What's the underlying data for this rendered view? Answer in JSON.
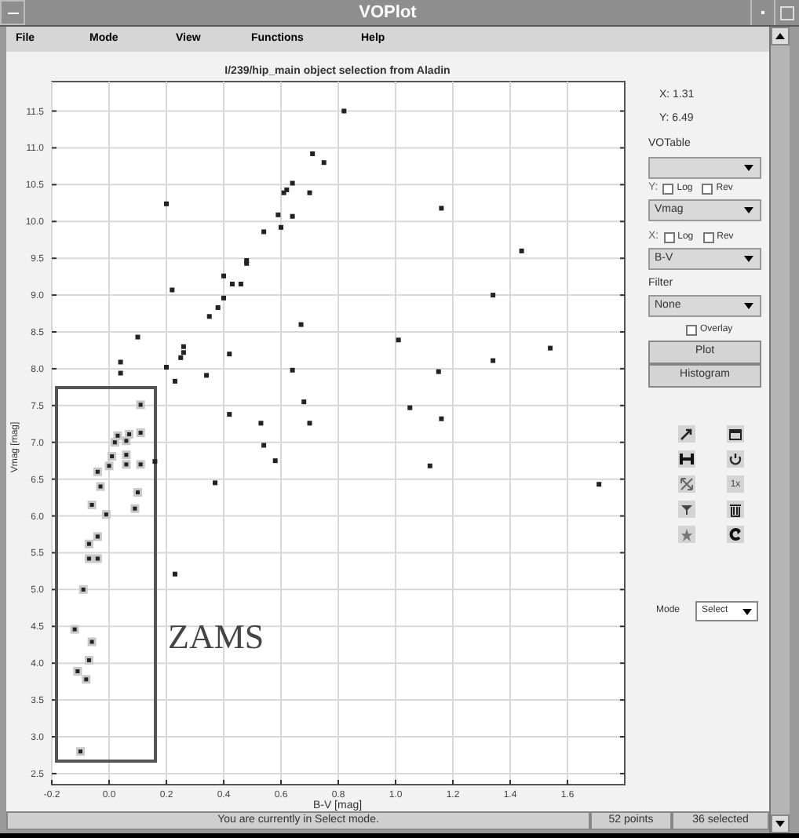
{
  "window": {
    "title": "VOPlot"
  },
  "menu": [
    "File",
    "Mode",
    "View",
    "Functions",
    "Help"
  ],
  "plot": {
    "chart_data": {
      "type": "scatter",
      "title": "I/239/hip_main object selection from Aladin",
      "xlabel": "B-V [mag]",
      "ylabel": "Vmag [mag]",
      "xlim": [
        -0.2,
        1.8
      ],
      "ylim": [
        2.35,
        11.9
      ],
      "xticks": [
        {
          "value": -0.2,
          "label": "-0.2"
        },
        {
          "value": 0,
          "label": "0.0"
        },
        {
          "value": 0.2,
          "label": "0.2"
        },
        {
          "value": 0.4,
          "label": "0.4"
        },
        {
          "value": 0.6,
          "label": "0.6"
        },
        {
          "value": 0.8,
          "label": "0.8"
        },
        {
          "value": 1,
          "label": "1.0"
        },
        {
          "value": 1.2,
          "label": "1.2"
        },
        {
          "value": 1.4,
          "label": "1.4"
        },
        {
          "value": 1.6,
          "label": "1.6"
        }
      ],
      "yticks": [
        {
          "value": 2.5,
          "label": "2.5"
        },
        {
          "value": 3,
          "label": "3.0"
        },
        {
          "value": 3.5,
          "label": "3.5"
        },
        {
          "value": 4,
          "label": "4.0"
        },
        {
          "value": 4.5,
          "label": "4.5"
        },
        {
          "value": 5,
          "label": "5.0"
        },
        {
          "value": 5.5,
          "label": "5.5"
        },
        {
          "value": 6,
          "label": "6.0"
        },
        {
          "value": 6.5,
          "label": "6.5"
        },
        {
          "value": 7,
          "label": "7.0"
        },
        {
          "value": 7.5,
          "label": "7.5"
        },
        {
          "value": 8,
          "label": "8.0"
        },
        {
          "value": 8.5,
          "label": "8.5"
        },
        {
          "value": 9,
          "label": "9.0"
        },
        {
          "value": 9.5,
          "label": "9.5"
        },
        {
          "value": 10,
          "label": "10.0"
        },
        {
          "value": 10.5,
          "label": "10.5"
        },
        {
          "value": 11,
          "label": "11.0"
        },
        {
          "value": 11.5,
          "label": "11.5"
        }
      ],
      "series": [
        {
          "color": "#222222",
          "x": [
            0.82,
            0.2,
            0.71,
            0.75,
            0.64,
            0.61,
            0.62,
            0.7,
            1.16,
            0.59,
            0.64,
            0.6,
            0.54,
            1.44,
            0.48,
            0.48,
            0.4,
            0.43,
            0.46,
            0.22,
            0.4,
            1.34,
            0.38,
            0.35,
            0.67,
            1.01,
            1.54,
            0.25,
            0.26,
            0.26,
            0.42,
            0.2,
            1.34,
            0.23,
            0.34,
            0.64,
            1.15,
            1.05,
            0.68,
            0.42,
            0.53,
            0.7,
            1.16,
            0.54,
            0.58,
            1.12,
            0.37,
            1.71,
            0.04,
            0.04,
            0.1,
            0.23,
            0.16
          ],
          "values": [
            11.5,
            10.24,
            10.92,
            10.8,
            10.52,
            10.39,
            10.43,
            10.39,
            10.18,
            10.09,
            10.07,
            9.92,
            9.86,
            9.6,
            9.43,
            9.47,
            9.26,
            9.15,
            9.15,
            9.07,
            8.96,
            9.0,
            8.83,
            8.71,
            8.6,
            8.39,
            8.28,
            8.15,
            8.3,
            8.22,
            8.2,
            8.02,
            8.11,
            7.83,
            7.91,
            7.98,
            7.96,
            7.47,
            7.55,
            7.38,
            7.26,
            7.26,
            7.32,
            6.96,
            6.75,
            6.68,
            6.45,
            6.43,
            8.09,
            7.94,
            8.43,
            5.21,
            6.74
          ]
        },
        {
          "color": "#222222",
          "x": [
            0.11,
            0.03,
            0.02,
            0.01,
            0.06,
            0.07,
            0.06,
            0.06,
            0.11,
            0.11,
            0.0,
            -0.04,
            -0.03,
            -0.06,
            0.1,
            0.09,
            -0.01,
            -0.04,
            -0.07,
            -0.07,
            -0.04,
            -0.09,
            -0.12,
            -0.06,
            -0.07,
            -0.11,
            -0.08,
            -0.1
          ],
          "values": [
            7.51,
            7.09,
            7.0,
            6.81,
            7.02,
            7.11,
            6.83,
            6.7,
            7.13,
            6.7,
            6.68,
            6.6,
            6.4,
            6.15,
            6.32,
            6.1,
            6.02,
            5.72,
            5.62,
            5.42,
            5.42,
            5.0,
            4.46,
            4.29,
            4.04,
            3.89,
            3.78,
            2.8
          ]
        }
      ],
      "grid": true,
      "annotations": [
        "ZAMS"
      ]
    }
  },
  "panel": {
    "x_readout": "X: 1.31",
    "y_readout": "Y: 6.49",
    "votable_label": "VOTable",
    "y_axis": {
      "label": "Y:",
      "log_label": "Log",
      "log_checked": false,
      "rev_label": "Rev",
      "rev_checked": false,
      "column": "Vmag"
    },
    "x_axis": {
      "label": "X:",
      "log_label": "Log",
      "log_checked": false,
      "rev_label": "Rev",
      "rev_checked": false,
      "column": "B-V"
    },
    "filter_label": "Filter",
    "filter": "None",
    "overlay_label": "Overlay",
    "overlay_checked": false,
    "buttons": [
      "Plot",
      "Histogram"
    ],
    "tools": [
      {
        "kind": "arrow"
      },
      {
        "kind": "window"
      },
      {
        "kind": "bracket"
      },
      {
        "kind": "cycle"
      },
      {
        "kind": "expand"
      },
      {
        "kind": "text",
        "label": "1x"
      },
      {
        "kind": "funnel"
      },
      {
        "kind": "trash"
      },
      {
        "kind": "star"
      },
      {
        "kind": "redo"
      }
    ],
    "mode_label": "Mode",
    "mode": "Select"
  },
  "status_bar": {
    "message": "You are currently in Select mode.",
    "points": "52 points",
    "selected": "36 selected"
  }
}
